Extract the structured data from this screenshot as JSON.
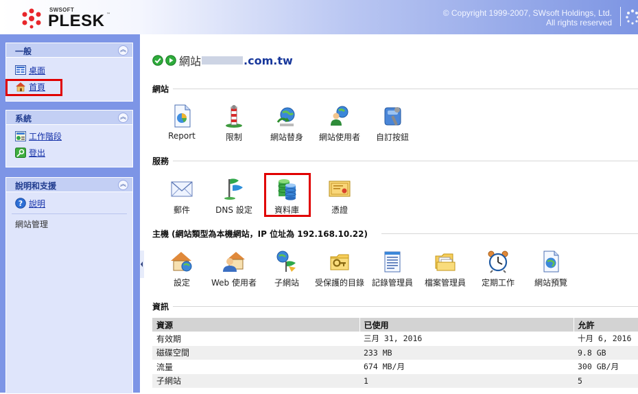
{
  "header": {
    "brand_small": "SWSOFT",
    "brand": "PLESK",
    "tm": "™",
    "copyright_line1": "© Copyright 1999-2007, SWsoft Holdings, Ltd.",
    "copyright_line2": "All rights reserved"
  },
  "sidebar": {
    "general": {
      "title": "一般",
      "items": [
        {
          "label": "桌面",
          "icon": "desktop-icon"
        },
        {
          "label": "首頁",
          "icon": "home-icon"
        }
      ]
    },
    "system": {
      "title": "系統",
      "items": [
        {
          "label": "工作階段",
          "icon": "sessions-icon"
        },
        {
          "label": "登出",
          "icon": "logout-icon"
        }
      ]
    },
    "help": {
      "title": "說明和支援",
      "items": [
        {
          "label": "說明",
          "icon": "help-icon"
        }
      ],
      "text": "網站管理"
    }
  },
  "main": {
    "title_label": "網站",
    "title_domain": ".com.tw",
    "sections": {
      "site": {
        "title": "網站",
        "tiles": [
          {
            "label": "Report",
            "icon": "report-icon"
          },
          {
            "label": "限制",
            "icon": "limits-icon"
          },
          {
            "label": "網站替身",
            "icon": "domain-alias-icon"
          },
          {
            "label": "網站使用者",
            "icon": "site-users-icon"
          },
          {
            "label": "自訂按鈕",
            "icon": "custom-buttons-icon"
          }
        ]
      },
      "services": {
        "title": "服務",
        "tiles": [
          {
            "label": "郵件",
            "icon": "mail-icon"
          },
          {
            "label": "DNS 設定",
            "icon": "dns-icon"
          },
          {
            "label": "資料庫",
            "icon": "database-icon"
          },
          {
            "label": "憑證",
            "icon": "certificate-icon"
          }
        ]
      },
      "hosting": {
        "title": "主機 (網站類型為本機網站，IP 位址為 192.168.10.22)",
        "tiles": [
          {
            "label": "設定",
            "icon": "setup-icon"
          },
          {
            "label": "Web 使用者",
            "icon": "web-users-icon"
          },
          {
            "label": "子網站",
            "icon": "subdomains-icon"
          },
          {
            "label": "受保護的目錄",
            "icon": "protected-dirs-icon"
          },
          {
            "label": "記錄管理員",
            "icon": "log-manager-icon"
          },
          {
            "label": "檔案管理員",
            "icon": "file-manager-icon"
          },
          {
            "label": "定期工作",
            "icon": "scheduled-tasks-icon"
          },
          {
            "label": "網站預覽",
            "icon": "site-preview-icon"
          }
        ]
      },
      "info": {
        "title": "資訊",
        "columns": [
          "資源",
          "已使用",
          "允許"
        ],
        "rows": [
          [
            "有效期",
            "三月 31, 2016",
            "十月 6, 2016"
          ],
          [
            "磁碟空間",
            "233 MB",
            "9.8 GB"
          ],
          [
            "流量",
            "674 MB/月",
            "300 GB/月"
          ],
          [
            "子網站",
            "1",
            "5"
          ]
        ]
      }
    }
  },
  "colors": {
    "sidebar_bg": "#7d95e6",
    "box_bg": "#dfe5fb",
    "link": "#1431a8",
    "highlight": "#e00000"
  }
}
